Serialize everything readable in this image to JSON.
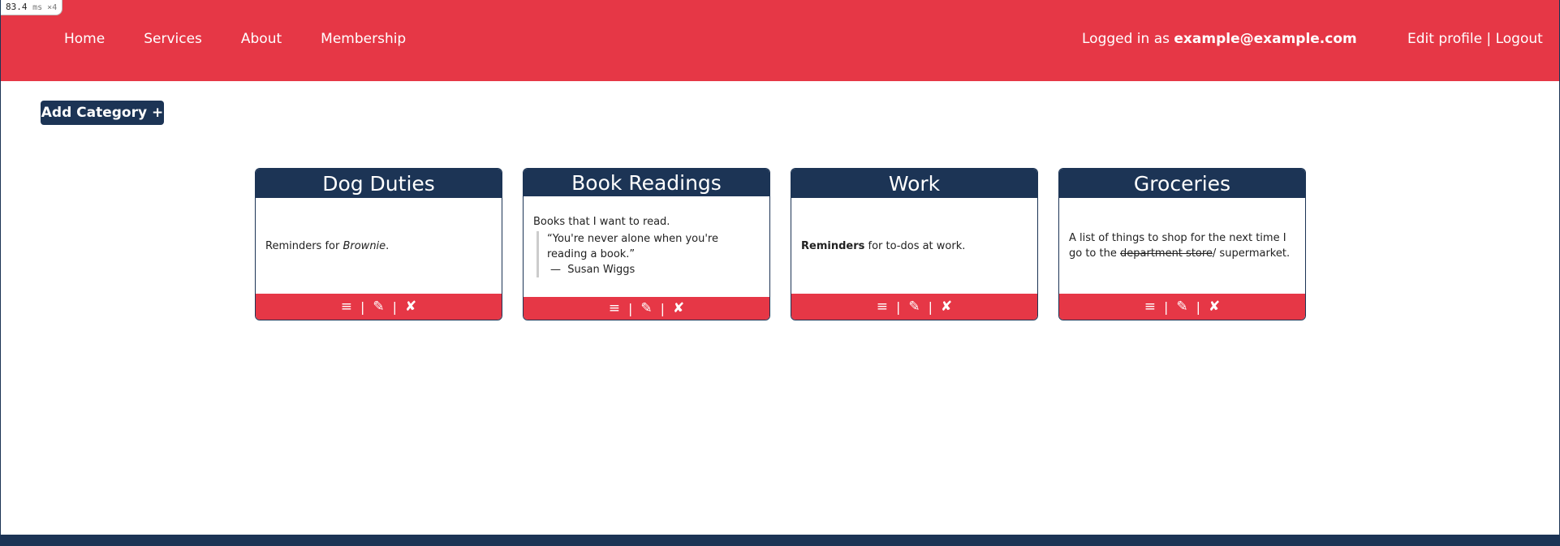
{
  "perf": {
    "value": "83.4",
    "unit": "ms ×4"
  },
  "nav": {
    "home": "Home",
    "services": "Services",
    "about": "About",
    "membership": "Membership"
  },
  "user": {
    "prefix": "Logged in as ",
    "email": "example@example.com",
    "edit_profile": "Edit profile",
    "separator": " | ",
    "logout": "Logout"
  },
  "add_category_label": "Add Category +",
  "card_actions": {
    "list": "≡",
    "edit": "✎",
    "delete": "✘",
    "sep": "|"
  },
  "cards": [
    {
      "title": "Dog Duties",
      "desc_prefix": "Reminders for ",
      "desc_em": "Brownie",
      "desc_suffix": "."
    },
    {
      "title": "Book Readings",
      "desc": "Books that I want to read.",
      "quote": "“You're never alone when you're reading a book.”",
      "quote_author": "—  Susan Wiggs"
    },
    {
      "title": "Work",
      "desc_bold": "Reminders",
      "desc_rest": " for to-dos at work."
    },
    {
      "title": "Groceries",
      "desc_prefix": "A list of things to shop for the next time I go to the ",
      "desc_strike": "department store",
      "desc_suffix": "/ supermarket."
    }
  ],
  "colors": {
    "primary_red": "#e63746",
    "navy": "#1c3455"
  }
}
